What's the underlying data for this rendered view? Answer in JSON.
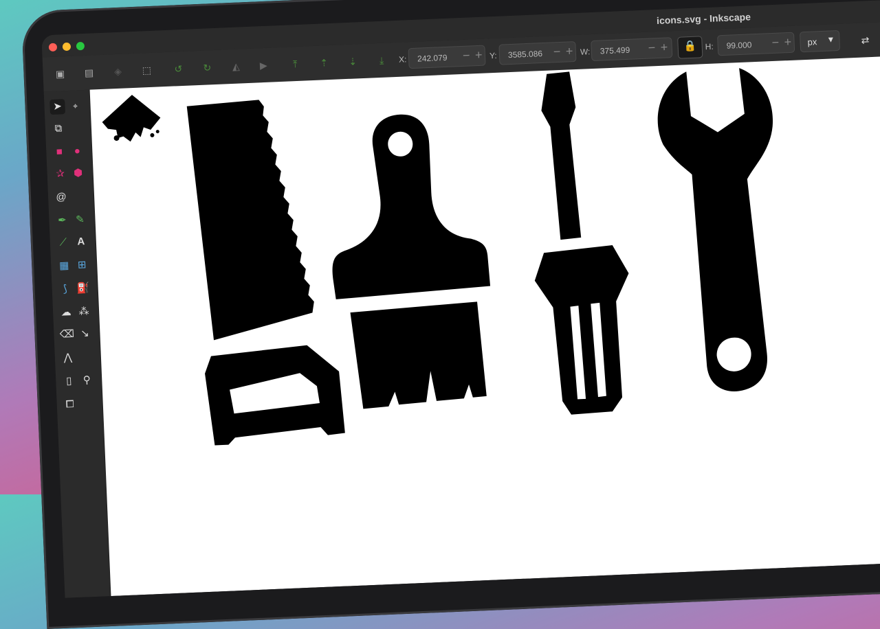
{
  "window": {
    "title": "icons.svg - Inkscape",
    "traffic_lights": {
      "close": "#ff5f57",
      "minimize": "#febc2e",
      "zoom": "#28c840"
    }
  },
  "toolbar": {
    "x_label": "X:",
    "x_value": "242.079",
    "y_label": "Y:",
    "y_value": "3585.086",
    "w_label": "W:",
    "w_value": "375.499",
    "h_label": "H:",
    "h_value": "99.000",
    "lock_icon": "lock-icon",
    "unit": "px",
    "icons": [
      "select-all-icon",
      "select-all-layers-icon",
      "deselect-icon",
      "select-same-icon",
      "rotate-ccw-icon",
      "rotate-cw-icon",
      "flip-horizontal-icon",
      "flip-vertical-icon",
      "raise-to-top-icon",
      "raise-icon",
      "lower-icon",
      "lower-to-bottom-icon"
    ]
  },
  "tools": [
    "selector-icon",
    "node-icon",
    "shape-builder-icon",
    "rectangle-icon",
    "circle-icon",
    "star-icon",
    "3d-box-icon",
    "spiral-icon",
    "pen-icon",
    "pencil-icon",
    "calligraphy-icon",
    "text-icon",
    "gradient-icon",
    "mesh-icon",
    "dropper-icon",
    "paint-bucket-icon",
    "tweak-icon",
    "spray-icon",
    "eraser-icon",
    "connector-icon",
    "measure-icon",
    "pages-icon",
    "zoom-icon",
    "clone-icon"
  ],
  "canvas": {
    "objects": [
      "inkscape-logo",
      "hand-saw-icon",
      "paintbrush-icon",
      "screwdriver-icon",
      "wrench-icon"
    ]
  }
}
